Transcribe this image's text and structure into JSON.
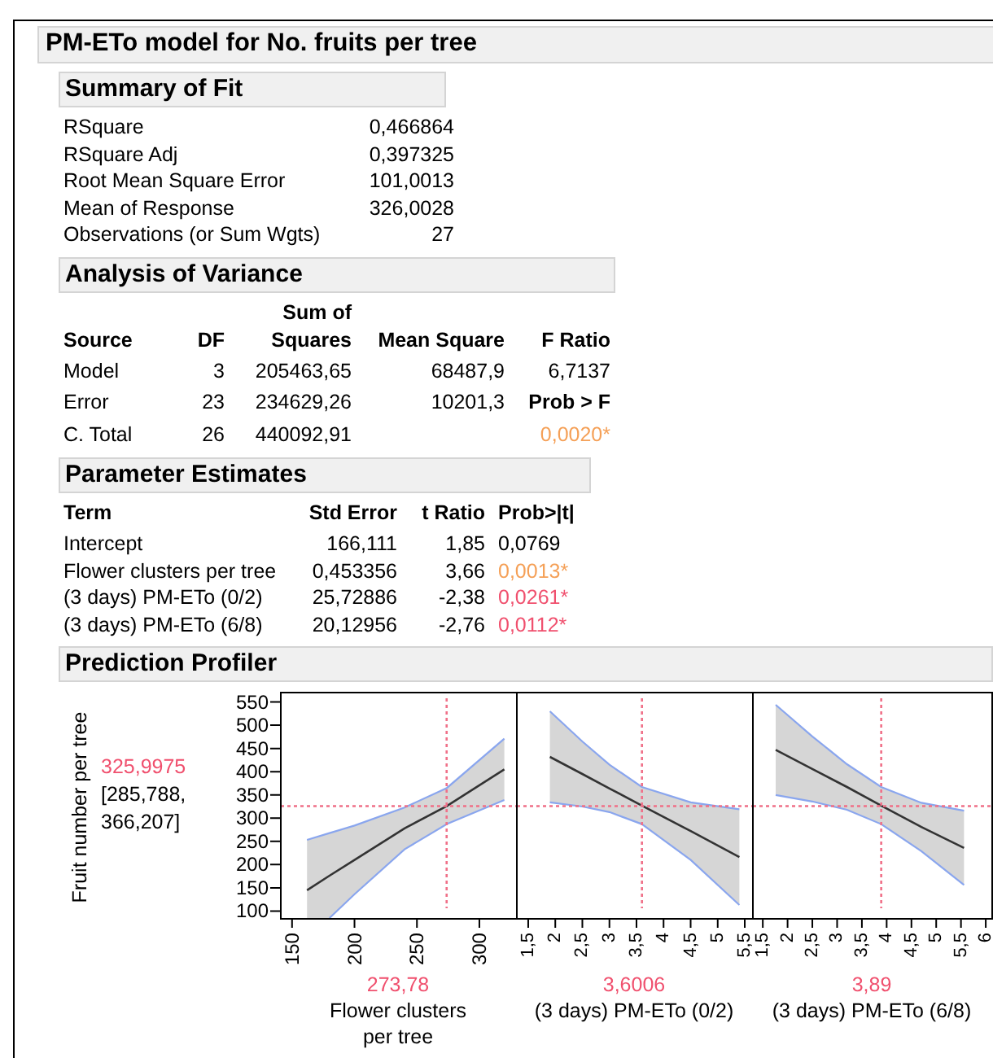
{
  "report": {
    "title": "PM-ETo model for No. fruits per tree",
    "summary_of_fit": {
      "title": "Summary of Fit",
      "rows": [
        {
          "label": "RSquare",
          "value": "0,466864"
        },
        {
          "label": "RSquare Adj",
          "value": "0,397325"
        },
        {
          "label": "Root Mean Square Error",
          "value": "101,0013"
        },
        {
          "label": "Mean of Response",
          "value": "326,0028"
        },
        {
          "label": "Observations (or Sum Wgts)",
          "value": "27"
        }
      ]
    },
    "analysis_of_variance": {
      "title": "Analysis of Variance",
      "columns": [
        "Source",
        "DF",
        "Sum of Squares",
        "Mean Square",
        "F Ratio"
      ],
      "rows": [
        {
          "source": "Model",
          "df": "3",
          "sum_of_squares": "205463,65",
          "mean_square": "68487,9",
          "f_ratio": "6,7137"
        },
        {
          "source": "Error",
          "df": "23",
          "sum_of_squares": "234629,26",
          "mean_square": "10201,3"
        },
        {
          "source": "C. Total",
          "df": "26",
          "sum_of_squares": "440092,91"
        }
      ],
      "prob_label": "Prob > F",
      "prob_value": {
        "text": "0,0020*",
        "color": "#f5a057"
      }
    },
    "parameter_estimates": {
      "title": "Parameter Estimates",
      "columns": [
        "Term",
        "Std Error",
        "t Ratio",
        "Prob>|t|"
      ],
      "rows": [
        {
          "term": "Intercept",
          "std_error": "166,111",
          "t_ratio": "1,85",
          "prob": "0,0769",
          "color": "#000000"
        },
        {
          "term": "Flower clusters per tree",
          "std_error": "0,453356",
          "t_ratio": "3,66",
          "prob": "0,0013*",
          "color": "#f5a057"
        },
        {
          "term": "(3 days) PM-ETo (0/2)",
          "std_error": "25,72886",
          "t_ratio": "-2,38",
          "prob": "0,0261*",
          "color": "#f0506e"
        },
        {
          "term": "(3 days) PM-ETo (6/8)",
          "std_error": "20,12956",
          "t_ratio": "-2,76",
          "prob": "0,0112*",
          "color": "#f0506e"
        }
      ]
    },
    "prediction_profiler": {
      "title": "Prediction Profiler",
      "response": {
        "label": "Fruit number per tree",
        "value": "325,9975",
        "interval": [
          "[285,788,",
          "366,207]"
        ]
      },
      "panels": [
        {
          "value": "273,78",
          "factor": "Flower clusters per tree",
          "chart_data": {
            "type": "line",
            "x": [
              162,
              180,
              200,
              240,
              274,
              320
            ],
            "series": [
              {
                "color": "#333333",
                "values": [
                  145,
                  176,
                  210,
                  278,
                  326,
                  405
                ]
              },
              {
                "color": "#8aa6ee",
                "values": [
                  253,
                  268,
                  284,
                  323,
                  365,
                  471
                ]
              },
              {
                "color": "#8aa6ee",
                "values": [
                  null,
                  85,
                  136,
                  233,
                  287,
                  339
                ]
              }
            ],
            "xlim": [
              141,
              330
            ],
            "ylim": [
              85,
              572
            ],
            "xticks": [
              150,
              200,
              250,
              300
            ],
            "yticks": [
              100,
              150,
              200,
              250,
              300,
              350,
              400,
              450,
              500,
              550
            ],
            "ref_lines": [
              {
                "axis": "x",
                "value": 273.78
              },
              {
                "axis": "y",
                "value": 325.9975
              }
            ]
          }
        },
        {
          "value": "3,6006",
          "factor": "(3 days) PM-ETo (0/2)",
          "chart_data": {
            "type": "line",
            "x": [
              1.9,
              2.5,
              3.0,
              3.6,
              4.5,
              5.4
            ],
            "series": [
              {
                "color": "#333333",
                "values": [
                  432,
                  395,
                  364,
                  327,
                  272,
                  216
                ]
              },
              {
                "color": "#8aa6ee",
                "values": [
                  530,
                  465,
                  415,
                  367,
                  334,
                  319
                ]
              },
              {
                "color": "#8aa6ee",
                "values": [
                  334,
                  325,
                  313,
                  287,
                  210,
                  113
                ]
              }
            ],
            "xlim": [
              1.29,
              5.65
            ],
            "ylim": [
              85,
              572
            ],
            "xticks": [
              {
                "value": 1.5,
                "label": "1,5"
              },
              {
                "value": 2,
                "label": "2"
              },
              {
                "value": 2.5,
                "label": "2,5"
              },
              {
                "value": 3,
                "label": "3"
              },
              {
                "value": 3.5,
                "label": "3,5"
              },
              {
                "value": 4,
                "label": "4"
              },
              {
                "value": 4.5,
                "label": "4,5"
              },
              {
                "value": 5,
                "label": "5"
              },
              {
                "value": 5.5,
                "label": "5,5"
              }
            ],
            "ref_lines": [
              {
                "axis": "x",
                "value": 3.6006
              },
              {
                "axis": "y",
                "value": 325.9975
              }
            ]
          }
        },
        {
          "value": "3,89",
          "factor": "(3 days) PM-ETo (6/8)",
          "chart_data": {
            "type": "line",
            "x": [
              1.76,
              2.5,
              3.2,
              3.89,
              4.7,
              5.56
            ],
            "series": [
              {
                "color": "#333333",
                "values": [
                  447,
                  406,
                  367,
                  327,
                  281,
                  236
                ]
              },
              {
                "color": "#8aa6ee",
                "values": [
                  544,
                  476,
                  416,
                  367,
                  333,
                  316
                ]
              },
              {
                "color": "#8aa6ee",
                "values": [
                  350,
                  336,
                  318,
                  287,
                  229,
                  156
                ]
              }
            ],
            "xlim": [
              1.3,
              6.13
            ],
            "ylim": [
              85,
              572
            ],
            "xticks": [
              {
                "value": 1.5,
                "label": "1,5"
              },
              {
                "value": 2,
                "label": "2"
              },
              {
                "value": 2.5,
                "label": "2,5"
              },
              {
                "value": 3,
                "label": "3"
              },
              {
                "value": 3.5,
                "label": "3,5"
              },
              {
                "value": 4,
                "label": "4"
              },
              {
                "value": 4.5,
                "label": "4,5"
              },
              {
                "value": 5,
                "label": "5"
              },
              {
                "value": 5.5,
                "label": "5,5"
              },
              {
                "value": 6,
                "label": "6"
              }
            ],
            "ref_lines": [
              {
                "axis": "x",
                "value": 3.89
              },
              {
                "axis": "y",
                "value": 325.9975
              }
            ]
          }
        }
      ]
    }
  }
}
